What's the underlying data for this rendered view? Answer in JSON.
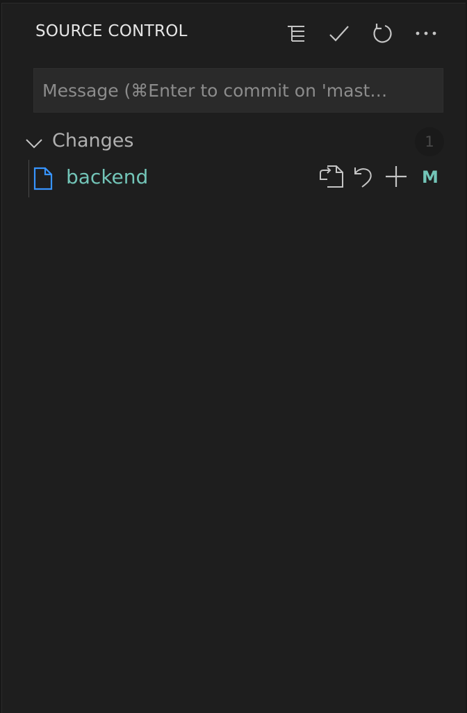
{
  "header": {
    "title": "SOURCE CONTROL",
    "actions": [
      {
        "icon": "tree-view-icon",
        "label": "View as Tree"
      },
      {
        "icon": "check-icon",
        "label": "Commit"
      },
      {
        "icon": "refresh-icon",
        "label": "Refresh"
      },
      {
        "icon": "more-actions-icon",
        "label": "More Actions"
      }
    ]
  },
  "commit_input": {
    "value": "",
    "placeholder": "Message (⌘Enter to commit on 'mast…"
  },
  "changes_group": {
    "label": "Changes",
    "count": "1"
  },
  "files": [
    {
      "name": "backend",
      "status": "M",
      "actions": [
        {
          "icon": "open-file-icon",
          "label": "Open File"
        },
        {
          "icon": "discard-changes-icon",
          "label": "Discard Changes"
        },
        {
          "icon": "stage-changes-icon",
          "label": "Stage Changes"
        }
      ]
    }
  ],
  "colors": {
    "background": "#1e1e1e",
    "modified_text": "#73c5b8",
    "file_icon": "#3794ff",
    "foreground": "#cccccc"
  }
}
